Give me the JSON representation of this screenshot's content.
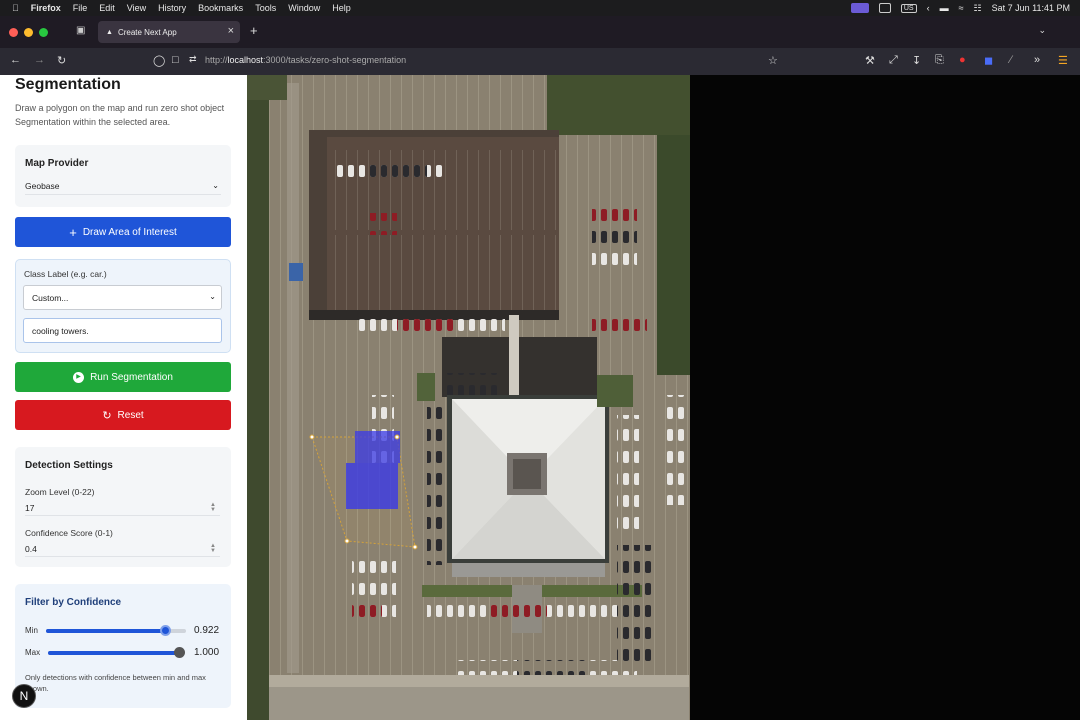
{
  "menubar": {
    "app": "Firefox",
    "items": [
      "File",
      "Edit",
      "View",
      "History",
      "Bookmarks",
      "Tools",
      "Window",
      "Help"
    ],
    "keyboard": "US",
    "clock": "Sat 7 Jun  11:41 PM"
  },
  "browser": {
    "tab_title": "Create Next App",
    "url_prefix": "http://",
    "url_host": "localhost",
    "url_path": ":3000/tasks/zero-shot-segmentation"
  },
  "panel": {
    "title": "Segmentation",
    "description": "Draw a polygon on the map and run zero shot object Segmentation within the selected area.",
    "map_provider": {
      "heading": "Map Provider",
      "selected": "Geobase"
    },
    "draw_button": "Draw Area of Interest",
    "class_label": {
      "label": "Class Label (e.g. car.)",
      "selected": "Custom...",
      "value": "cooling towers."
    },
    "run_button": "Run Segmentation",
    "reset_button": "Reset",
    "detection": {
      "heading": "Detection Settings",
      "zoom_label": "Zoom Level (0-22)",
      "zoom_value": "17",
      "confidence_label": "Confidence Score (0-1)",
      "confidence_value": "0.4"
    },
    "filter": {
      "heading": "Filter by Confidence",
      "min_label": "Min",
      "min_value": "0.922",
      "min_fraction": 0.922,
      "max_label": "Max",
      "max_value": "1.000",
      "max_fraction": 1.0,
      "note": "Only detections with confidence between min and max shown."
    }
  },
  "colors": {
    "primary_blue": "#1f55d8",
    "run_green": "#1fa83a",
    "reset_red": "#d7191f",
    "detection_fill": "#3a3ae8"
  }
}
